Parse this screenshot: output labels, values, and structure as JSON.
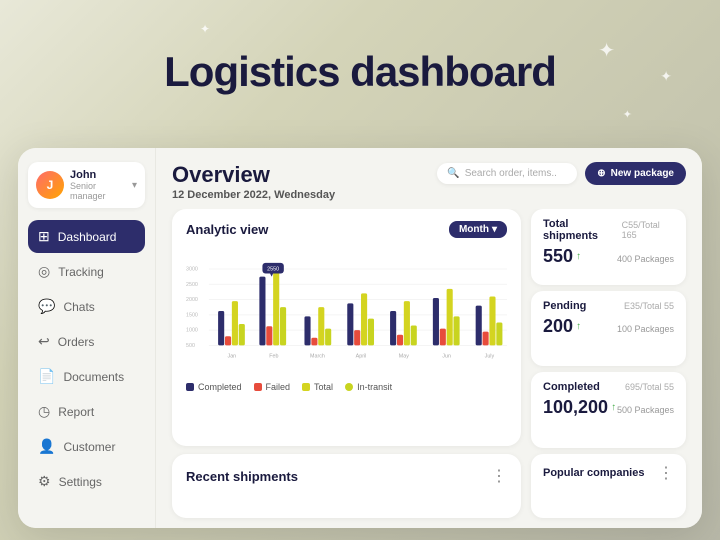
{
  "page": {
    "title": "Logistics dashboard",
    "bg_sparkles": [
      "✦",
      "✦",
      "✦",
      "✦",
      "✦"
    ]
  },
  "sidebar": {
    "user": {
      "name": "John",
      "role": "Senior manager",
      "avatar_initials": "J"
    },
    "nav_items": [
      {
        "id": "dashboard",
        "label": "Dashboard",
        "icon": "⊞",
        "active": true
      },
      {
        "id": "tracking",
        "label": "Tracking",
        "icon": "◎",
        "active": false
      },
      {
        "id": "chats",
        "label": "Chats",
        "icon": "💬",
        "active": false
      },
      {
        "id": "orders",
        "label": "Orders",
        "icon": "↩",
        "active": false
      },
      {
        "id": "documents",
        "label": "Documents",
        "icon": "📄",
        "active": false
      },
      {
        "id": "report",
        "label": "Report",
        "icon": "◷",
        "active": false
      },
      {
        "id": "customer",
        "label": "Customer",
        "icon": "👤",
        "active": false
      },
      {
        "id": "settings",
        "label": "Settings",
        "icon": "⚙",
        "active": false
      }
    ]
  },
  "header": {
    "title": "Overview",
    "date": "12 December 2022,",
    "day": "Wednesday",
    "search_placeholder": "Search order, items..",
    "new_package_label": "New package"
  },
  "analytic": {
    "title": "Analytic view",
    "period_label": "Month",
    "chart": {
      "y_labels": [
        "3000",
        "2500",
        "2000",
        "1500",
        "1000",
        "500"
      ],
      "x_labels": [
        "Jan",
        "Feb",
        "March",
        "April",
        "May",
        "Jun",
        "July"
      ],
      "tooltip": "2550",
      "bars": [
        {
          "month": "Jan",
          "completed": 55,
          "failed": 20,
          "total": 70,
          "intransit": 35
        },
        {
          "month": "Feb",
          "completed": 90,
          "failed": 30,
          "total": 100,
          "intransit": 50
        },
        {
          "month": "March",
          "completed": 45,
          "failed": 15,
          "total": 60,
          "intransit": 30
        },
        {
          "month": "April",
          "completed": 65,
          "failed": 25,
          "total": 80,
          "intransit": 40
        },
        {
          "month": "May",
          "completed": 55,
          "failed": 20,
          "total": 70,
          "intransit": 35
        },
        {
          "month": "Jun",
          "completed": 70,
          "failed": 25,
          "total": 85,
          "intransit": 42
        },
        {
          "month": "July",
          "completed": 60,
          "failed": 22,
          "total": 75,
          "intransit": 38
        }
      ]
    },
    "legend": [
      {
        "label": "Completed",
        "color": "#2d2d6b"
      },
      {
        "label": "Failed",
        "color": "#e74c3c"
      },
      {
        "label": "Total",
        "color": "#c8c820"
      },
      {
        "label": "In-transit",
        "color": "#c8c820"
      }
    ]
  },
  "recent_shipments": {
    "title": "Recent shipments"
  },
  "stats": [
    {
      "id": "total-shipments",
      "label": "Total shipments",
      "percent": "C55/Total 165",
      "value": "550",
      "arrow": "↑",
      "packages": "400 Packages"
    },
    {
      "id": "pending",
      "label": "Pending",
      "percent": "E35/Total 55",
      "value": "200",
      "arrow": "↑",
      "packages": "100 Packages"
    },
    {
      "id": "completed",
      "label": "Completed",
      "percent": "695/Total 55",
      "value": "100,200",
      "arrow": "↑",
      "packages": "500 Packages"
    }
  ],
  "popular_companies": {
    "title": "Popular companies"
  }
}
